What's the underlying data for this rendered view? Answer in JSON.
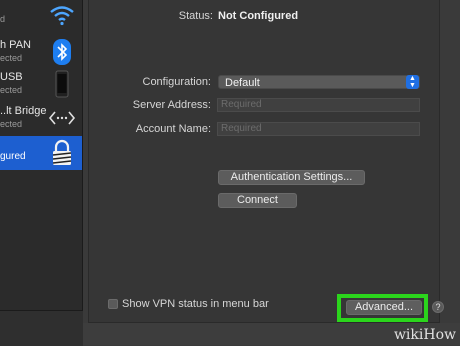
{
  "sidebar": {
    "items": [
      {
        "name": "",
        "sub": "d",
        "icon": "wifi-icon"
      },
      {
        "name": "h PAN",
        "sub": "ected",
        "icon": "bluetooth-icon"
      },
      {
        "name": "USB",
        "sub": "ected",
        "icon": "phone-icon"
      },
      {
        "name": "..lt Bridge",
        "sub": "ected",
        "icon": "bridge-arrows-icon"
      },
      {
        "name": "",
        "sub": "gured",
        "icon": "vpn-lock-icon",
        "selected": true
      }
    ]
  },
  "status": {
    "label": "Status:",
    "value": "Not Configured"
  },
  "config": {
    "label": "Configuration:",
    "value": "Default"
  },
  "server": {
    "label": "Server Address:",
    "placeholder": "Required"
  },
  "account": {
    "label": "Account Name:",
    "placeholder": "Required"
  },
  "buttons": {
    "auth": "Authentication Settings...",
    "connect": "Connect",
    "advanced": "Advanced..."
  },
  "show_vpn": {
    "label": "Show VPN status in menu bar",
    "checked": false
  },
  "help": "?",
  "watermark": "wikiHow",
  "colors": {
    "accent": "#1f6fe3",
    "highlight": "#2bd51c"
  }
}
